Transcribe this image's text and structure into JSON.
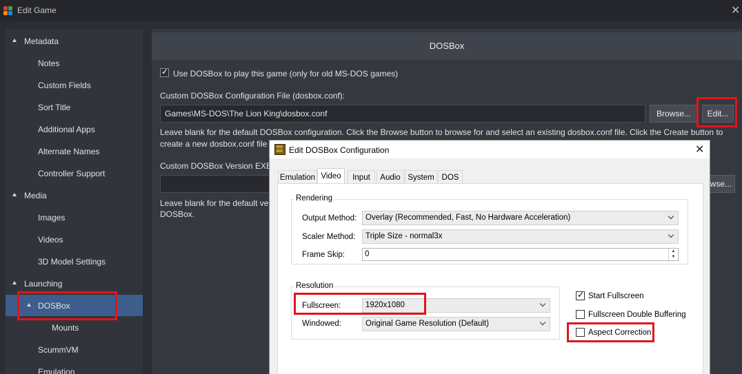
{
  "window": {
    "title": "Edit Game",
    "close_glyph": "✕"
  },
  "sidebar": {
    "items": [
      {
        "label": "Metadata",
        "level": 0,
        "expanded": true
      },
      {
        "label": "Notes",
        "level": 1
      },
      {
        "label": "Custom Fields",
        "level": 1
      },
      {
        "label": "Sort Title",
        "level": 1
      },
      {
        "label": "Additional Apps",
        "level": 1
      },
      {
        "label": "Alternate Names",
        "level": 1
      },
      {
        "label": "Controller Support",
        "level": 1
      },
      {
        "label": "Media",
        "level": 0,
        "expanded": true
      },
      {
        "label": "Images",
        "level": 1
      },
      {
        "label": "Videos",
        "level": 1
      },
      {
        "label": "3D Model Settings",
        "level": 1
      },
      {
        "label": "Launching",
        "level": 0,
        "expanded": true
      },
      {
        "label": "DOSBox",
        "level": 1,
        "expanded": true,
        "selected": true
      },
      {
        "label": "Mounts",
        "level": 2
      },
      {
        "label": "ScummVM",
        "level": 1
      },
      {
        "label": "Emulation",
        "level": 1
      }
    ]
  },
  "dosbox": {
    "header": "DOSBox",
    "use_dosbox_label": "Use DOSBox to play this game (only for old MS-DOS games)",
    "use_dosbox_checked": true,
    "config_file_label": "Custom DOSBox Configuration File (dosbox.conf):",
    "config_file_value": "Games\\MS-DOS\\The Lion King\\dosbox.conf",
    "browse_label": "Browse...",
    "edit_label": "Edit...",
    "config_help_line1": "Leave blank for the default DOSBox configuration. Click the Browse button to browse for and select an existing dosbox.conf file. Click the Create button to",
    "config_help_line2": "create a new dosbox.conf file",
    "version_label": "Custom DOSBox Version EXE",
    "version_value": "",
    "version_browse_label": "Browse...",
    "version_help_line1": "Leave blank for the default ve",
    "version_help_line2": "DOSBox."
  },
  "dialog": {
    "title": "Edit DOSBox Configuration",
    "close_glyph": "✕",
    "icon_text": [
      "DOS",
      "BOX"
    ],
    "tabs": [
      "Emulation",
      "Video",
      "Input",
      "Audio",
      "System",
      "DOS"
    ],
    "active_tab": "Video",
    "rendering": {
      "title": "Rendering",
      "output_method_label": "Output Method:",
      "output_method_value": "Overlay (Recommended, Fast, No Hardware Acceleration)",
      "scaler_method_label": "Scaler Method:",
      "scaler_method_value": "Triple Size - normal3x",
      "frame_skip_label": "Frame Skip:",
      "frame_skip_value": "0"
    },
    "resolution": {
      "title": "Resolution",
      "fullscreen_label": "Fullscreen:",
      "fullscreen_value": "1920x1080",
      "windowed_label": "Windowed:",
      "windowed_value": "Original Game Resolution (Default)"
    },
    "options": [
      {
        "label": "Start Fullscreen",
        "checked": true
      },
      {
        "label": "Fullscreen Double Buffering",
        "checked": false
      },
      {
        "label": "Aspect Correction",
        "checked": false
      }
    ]
  },
  "colors": {
    "window_bg": "#2b2d33",
    "sidebar_bg": "#31343b",
    "selected_bg": "#3d5e8d",
    "highlight": "#e2141c"
  }
}
